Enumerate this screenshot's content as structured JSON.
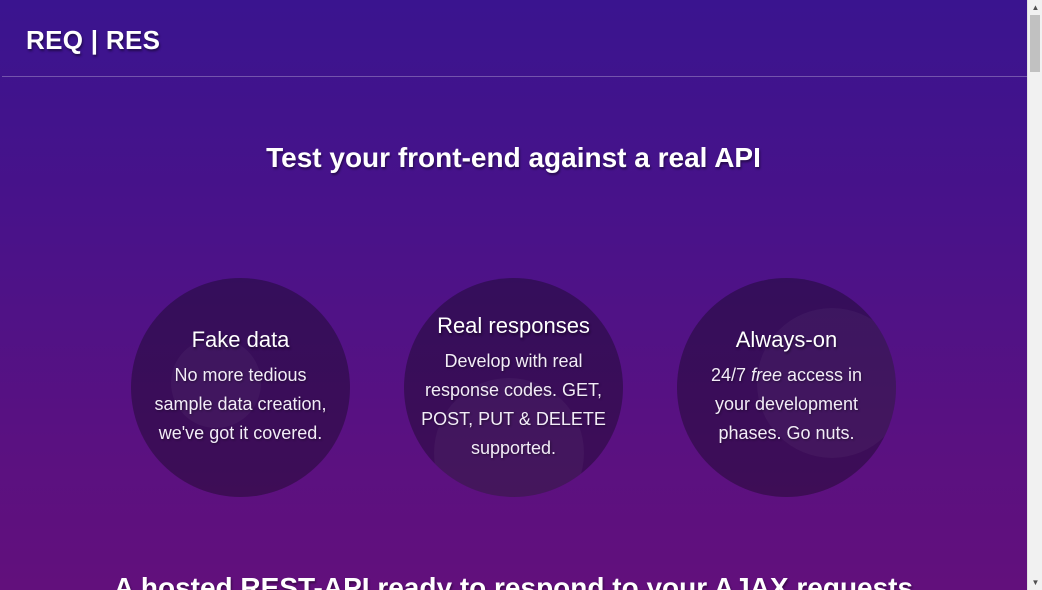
{
  "header": {
    "logo": "REQ | RES"
  },
  "hero": {
    "title": "Test your front-end against a real API"
  },
  "features": [
    {
      "title": "Fake data",
      "text": "No more tedious sample data creation, we've got it covered."
    },
    {
      "title": "Real responses",
      "text": "Develop with real response codes. GET, POST, PUT & DELETE supported."
    },
    {
      "title": "Always-on",
      "text_before": "24/7 ",
      "text_em": "free",
      "text_after": " access in your development phases. Go nuts."
    }
  ],
  "section": {
    "title": "A hosted REST-API ready to respond to your AJAX requests"
  },
  "scrollbar": {
    "up_icon": "▲",
    "down_icon": "▼"
  },
  "colors": {
    "bg_top": "#3a148f",
    "bg_bottom": "#62107c",
    "circle": "#2a1338"
  }
}
